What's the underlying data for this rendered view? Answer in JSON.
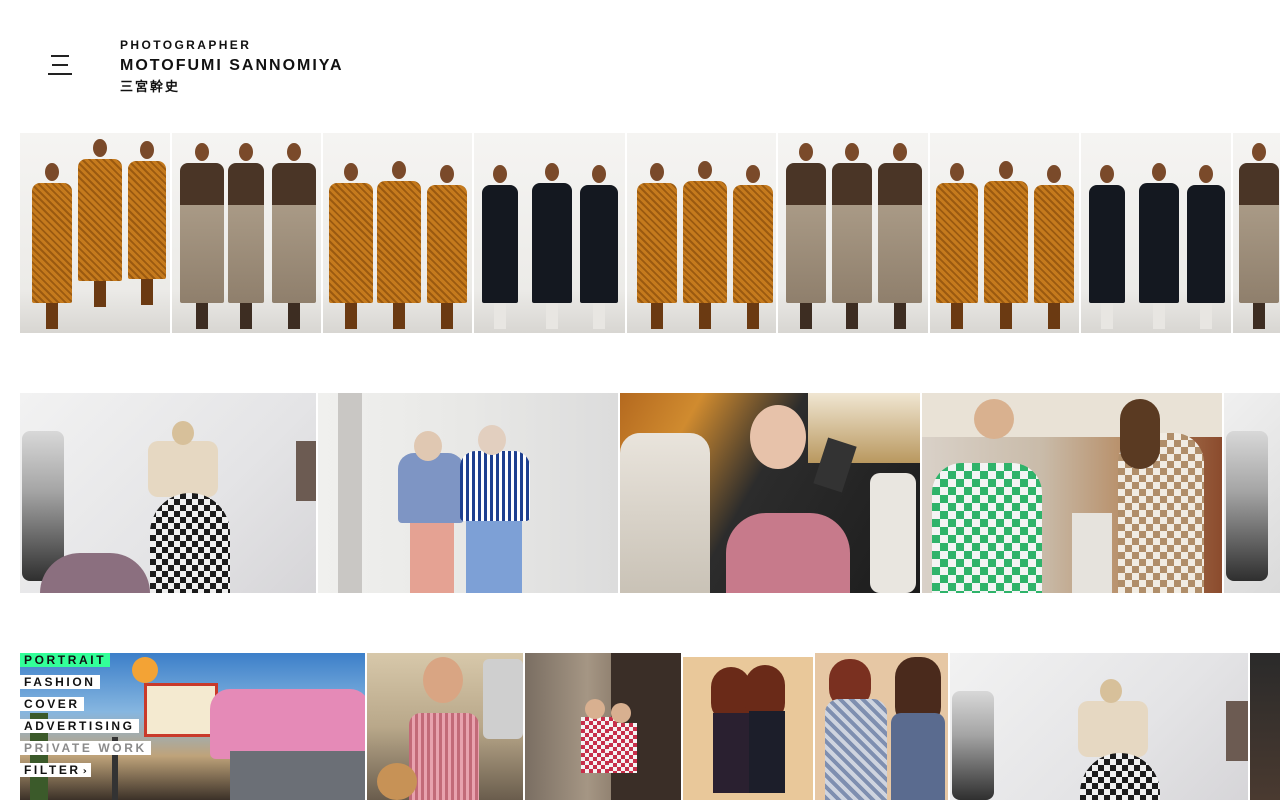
{
  "header": {
    "role": "PHOTOGRAPHER",
    "name": "MOTOFUMI SANNOMIYA",
    "name_jp": "三宮幹史",
    "menu_icon": "menu-icon"
  },
  "filters": {
    "items": [
      {
        "label": "PORTRAIT",
        "state": "active"
      },
      {
        "label": "FASHION",
        "state": "normal"
      },
      {
        "label": "COVER",
        "state": "normal"
      },
      {
        "label": "ADVERTISING",
        "state": "normal"
      },
      {
        "label": "PRIVATE WORK",
        "state": "muted"
      }
    ],
    "filter_label": "FILTER",
    "filter_icon": "chevron-right-icon",
    "accent_color": "#33ff99"
  },
  "gallery": {
    "row1": [
      "orange",
      "beige",
      "orange",
      "black",
      "orange",
      "beige",
      "orange",
      "black",
      "beige"
    ],
    "row2_count": 5,
    "row3_count": 7
  }
}
